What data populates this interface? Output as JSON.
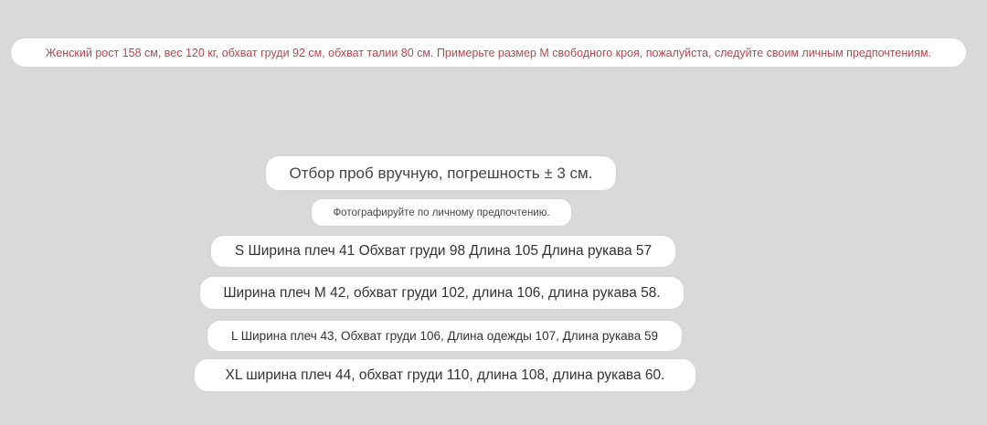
{
  "model_note": {
    "text": "Женский рост 158 см, вес 120 кг, обхват груди 92 см, обхват талии 80 см. Примерьте размер M свободного кроя, пожалуйста, следуйте своим личным предпочтениям.",
    "color": "#b5474f"
  },
  "manual_note": "Отбор проб вручную, погрешность ± 3 см.",
  "photo_note": "Фотографируйте по личному предпочтению.",
  "sizes": [
    "S Ширина плеч 41 Обхват груди 98 Длина 105 Длина рукава 57",
    "Ширина плеч M 42, обхват груди 102, длина 106, длина рукава 58.",
    "L Ширина плеч 43, Обхват груди 106, Длина одежды 107, Длина рукава 59",
    "XL ширина плеч 44, обхват груди 110, длина 108, длина рукава 60."
  ],
  "background_color": "#d9d9d9"
}
